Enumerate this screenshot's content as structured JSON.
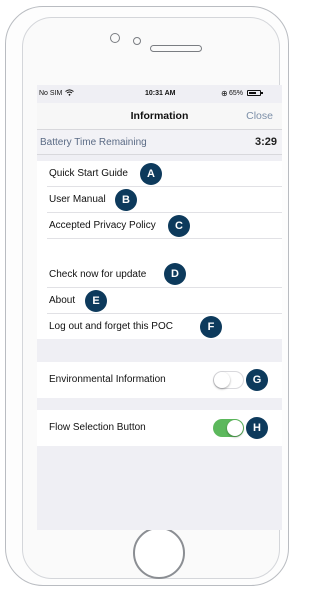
{
  "status_bar": {
    "carrier": "No SIM",
    "wifi_icon": "wifi-icon",
    "time": "10:31 AM",
    "battery_percent": "65%",
    "battery_level": 0.65
  },
  "nav": {
    "title": "Information",
    "close_label": "Close"
  },
  "battery_time": {
    "label": "Battery Time Remaining",
    "value": "3:29"
  },
  "menu_group_1": [
    {
      "label": "Quick Start Guide",
      "badge": "A"
    },
    {
      "label": "User Manual",
      "badge": "B"
    },
    {
      "label": "Accepted Privacy Policy",
      "badge": "C"
    }
  ],
  "menu_group_2": [
    {
      "label": "Check now for update",
      "badge": "D"
    },
    {
      "label": "About",
      "badge": "E"
    },
    {
      "label": "Log out and forget this POC",
      "badge": "F"
    }
  ],
  "toggles": [
    {
      "label": "Environmental Information",
      "state": "off",
      "badge": "G"
    },
    {
      "label": "Flow Selection Button",
      "state": "on",
      "badge": "H"
    }
  ],
  "colors": {
    "badge": "#0d3a5c",
    "toggle_on": "#5cb85c",
    "link": "#7c8fa8"
  }
}
